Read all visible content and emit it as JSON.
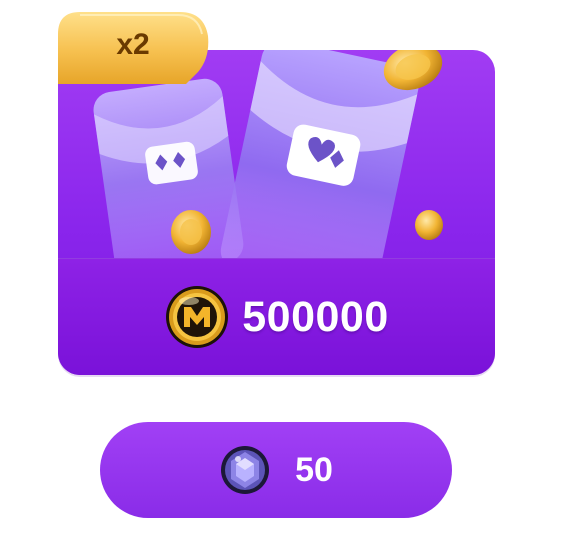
{
  "offer": {
    "multiplier_label": "x2",
    "amount": "500000",
    "currency_icon": "gold-m-coin-icon",
    "art_icon": "card-pouch-icon"
  },
  "purchase": {
    "price": "50",
    "price_icon": "purple-gem-icon"
  },
  "colors": {
    "card_purple": "#9a32f0",
    "footer_purple": "#7a12d9",
    "button_purple": "#9636ee",
    "badge_gold": "#f7c45a",
    "badge_text": "#6a3a00",
    "text_white": "#ffffff"
  }
}
